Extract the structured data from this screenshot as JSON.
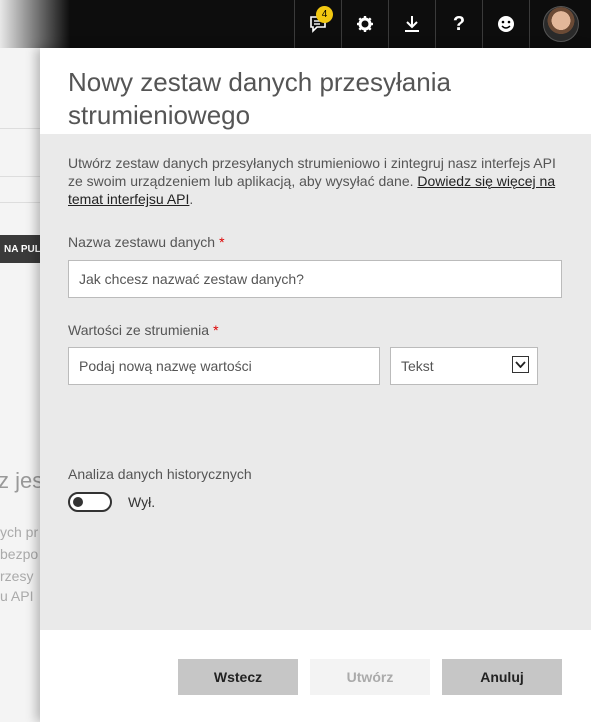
{
  "topbar": {
    "notifications_count": "4",
    "icons": [
      "notifications-icon",
      "settings-icon",
      "download-icon",
      "help-icon",
      "feedback-smiley-icon",
      "user-avatar"
    ]
  },
  "background": {
    "pill_text": "NA PUL",
    "big_text": "z jes",
    "lines": [
      "ych pr",
      "bezpo",
      "rzesy",
      "u API"
    ]
  },
  "panel": {
    "title": "Nowy zestaw danych przesyłania strumieniowego",
    "description": "Utwórz zestaw danych przesyłanych strumieniowo i zintegruj nasz interfejs API ze swoim urządzeniem lub aplikacją, aby wysyłać dane. ",
    "learn_more_link": "Dowiedz się więcej na temat interfejsu API",
    "description_end": ".",
    "dataset_name": {
      "label": "Nazwa zestawu danych",
      "required_marker": "*",
      "placeholder": "Jak chcesz nazwać zestaw danych?"
    },
    "stream_values": {
      "label": "Wartości ze strumienia",
      "required_marker": "*",
      "placeholder": "Podaj nową nazwę wartości",
      "type_selected": "Tekst"
    },
    "historic": {
      "label": "Analiza danych historycznych",
      "toggle_state": "Wył."
    },
    "buttons": {
      "back": "Wstecz",
      "create": "Utwórz",
      "cancel": "Anuluj"
    }
  },
  "colors": {
    "topbar": "#0d0d0d",
    "badge": "#f2c811",
    "required": "#dd0000",
    "panel_body": "#eaeaea"
  }
}
